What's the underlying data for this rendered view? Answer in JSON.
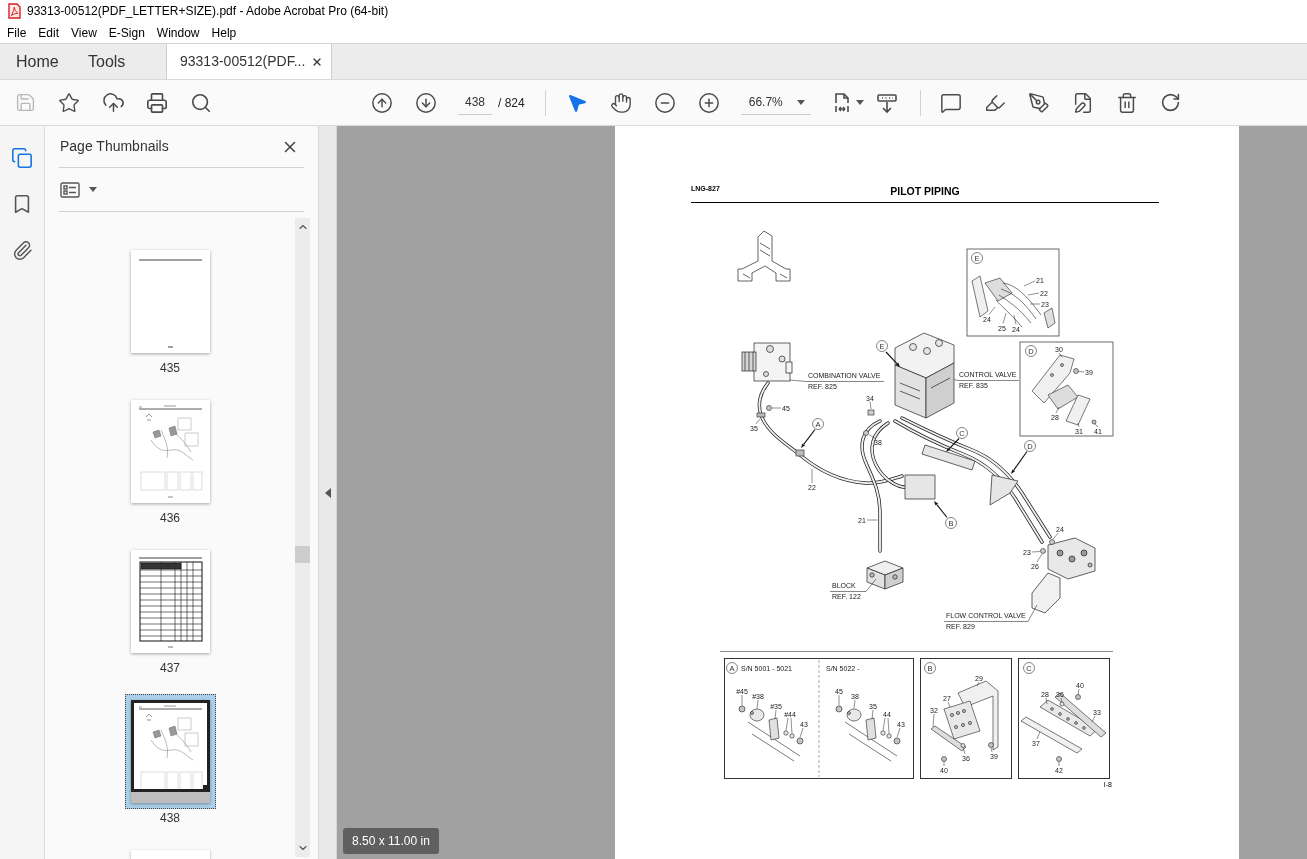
{
  "window": {
    "title": "93313-00512(PDF_LETTER+SIZE).pdf - Adobe Acrobat Pro (64-bit)"
  },
  "menu": [
    "File",
    "Edit",
    "View",
    "E-Sign",
    "Window",
    "Help"
  ],
  "tabs": [
    {
      "label": "Home",
      "kind": "nav",
      "selected": false
    },
    {
      "label": "Tools",
      "kind": "nav",
      "selected": false
    },
    {
      "label": "93313-00512(PDF...",
      "kind": "document",
      "selected": true
    }
  ],
  "toolbar": {
    "save": {
      "disabled": true
    },
    "page": {
      "value": "438",
      "total": "/ 824"
    },
    "tools": [
      {
        "kind": "select",
        "selected": true
      },
      {
        "kind": "pan",
        "selected": false
      }
    ],
    "zoom": {
      "value": "66.7%"
    }
  },
  "nav_rail": [
    {
      "kind": "pages",
      "selected": true
    },
    {
      "kind": "bookmarks",
      "selected": false
    },
    {
      "kind": "attachments",
      "selected": false
    }
  ],
  "thumbnails_panel": {
    "title": "Page Thumbnails",
    "thumbnails": [
      {
        "label": "435",
        "kind": "blank",
        "selected": false
      },
      {
        "label": "436",
        "kind": "diagram",
        "selected": false
      },
      {
        "label": "437",
        "kind": "table",
        "selected": false
      },
      {
        "label": "438",
        "kind": "diagram",
        "selected": true
      }
    ]
  },
  "document": {
    "code": "LNG-827",
    "title": "PILOT PIPING",
    "callouts": [
      {
        "name": "COMBINATION VALVE",
        "ref": "REF. 825"
      },
      {
        "name": "CONTROL VALVE",
        "ref": "REF. 835"
      },
      {
        "name": "BLOCK",
        "ref": "REF. 122"
      },
      {
        "name": "FLOW CONTROL VALVE",
        "ref": "REF. 829"
      }
    ],
    "detail_markers": [
      "E",
      "A",
      "C",
      "D",
      "B"
    ],
    "part_numbers": [
      "45",
      "35",
      "34",
      "38",
      "22",
      "21",
      "24",
      "23",
      "26"
    ],
    "detail_e": {
      "marker": "E",
      "part_numbers": [
        "21",
        "22",
        "23",
        "24",
        "25",
        "24"
      ]
    },
    "detail_d": {
      "marker": "D",
      "part_numbers": [
        "30",
        "39",
        "28",
        "31",
        "41"
      ]
    },
    "details": [
      {
        "kind": "clamp_variants",
        "marker": "A",
        "variants": [
          {
            "serial": "S/N 5001 - 5021",
            "part_numbers": [
              "#45",
              "#38",
              "#35",
              "#44",
              "43"
            ]
          },
          {
            "serial": "S/N 5022 -",
            "part_numbers": [
              "45",
              "38",
              "35",
              "44",
              "43"
            ]
          }
        ]
      },
      {
        "kind": "bracket",
        "marker": "B",
        "part_numbers": [
          "29",
          "27",
          "32",
          "36",
          "39",
          "40"
        ]
      },
      {
        "kind": "clamp_bar",
        "marker": "C",
        "part_numbers": [
          "28",
          "36",
          "40",
          "33",
          "37",
          "42"
        ]
      }
    ],
    "page_label": "I-8"
  },
  "page_size": "8.50 x 11.00 in"
}
